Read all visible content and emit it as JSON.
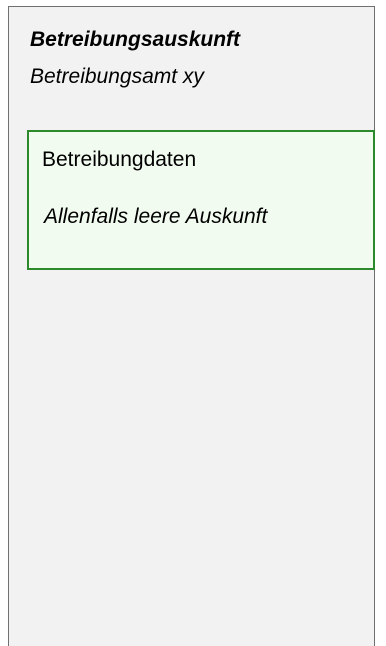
{
  "panel": {
    "title": "Betreibungsauskunft",
    "subtitle": "Betreibungsamt xy"
  },
  "data_box": {
    "title": "Betreibungdaten",
    "note": "Allenfalls leere Auskunft"
  },
  "colors": {
    "panel_background": "#f2f2f2",
    "box_border": "#2c8a2c",
    "box_background": "#f2fbef"
  }
}
